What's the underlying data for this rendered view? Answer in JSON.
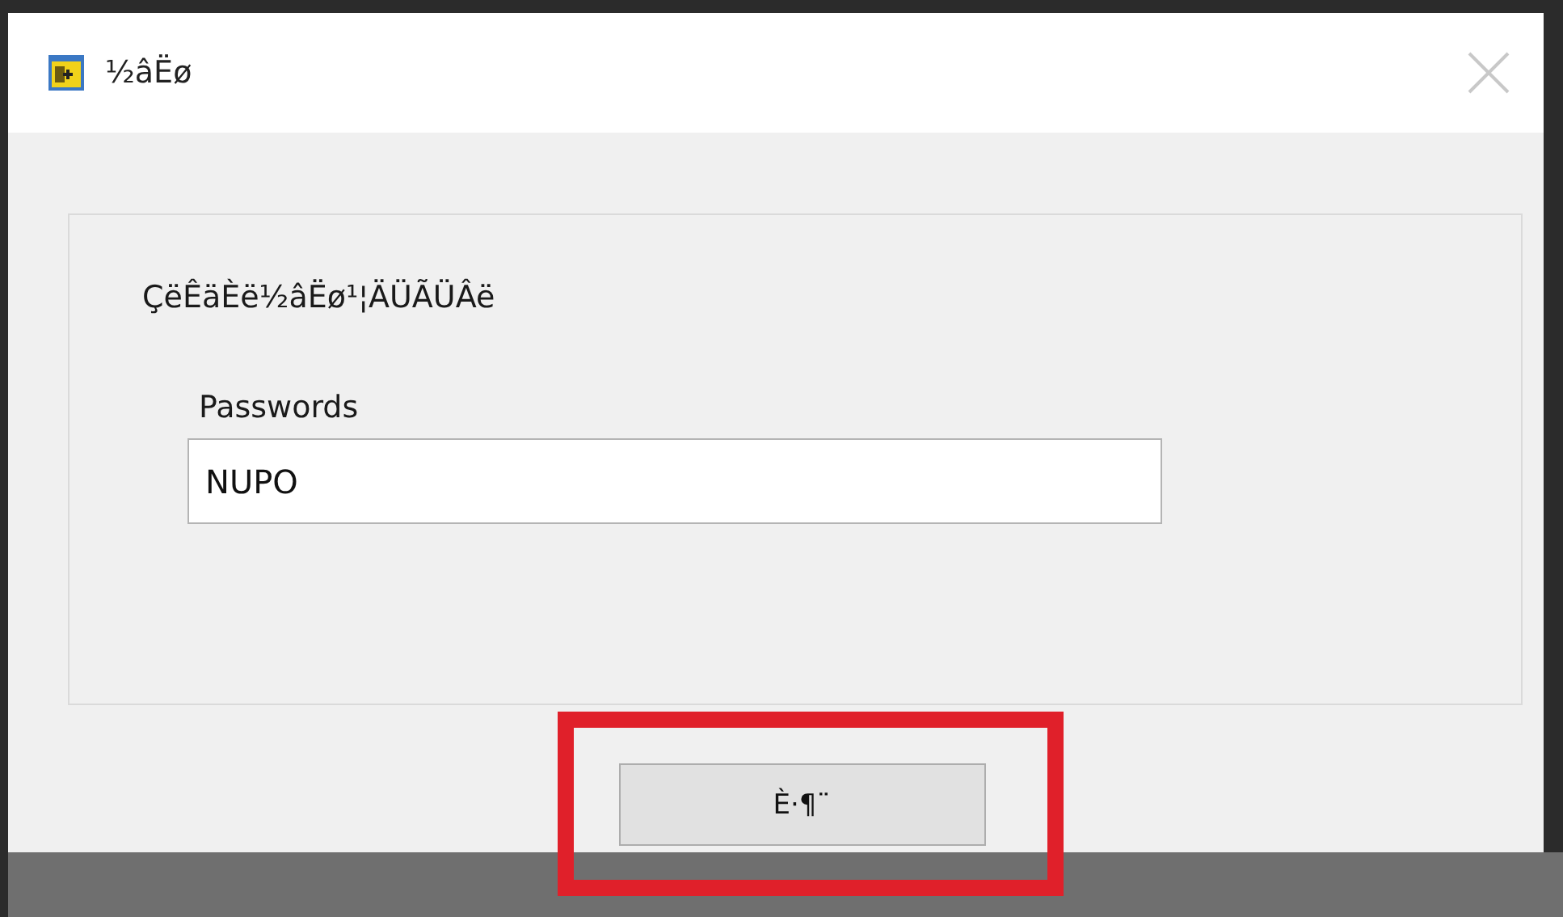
{
  "window": {
    "title": "½âËø"
  },
  "dialog": {
    "message": "ÇëÊäÈë½âËø¹¦ÄÜÃÜÂë",
    "field": {
      "label": "Passwords",
      "value": "NUPO"
    }
  },
  "buttons": [
    {
      "label": "È·¶¨",
      "highlighted": true
    }
  ]
}
